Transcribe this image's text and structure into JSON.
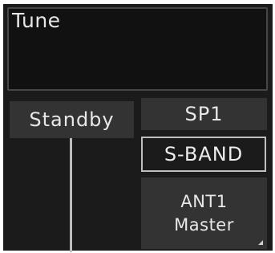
{
  "tune": {
    "label": "Tune"
  },
  "status": {
    "standby_label": "Standby"
  },
  "controls": {
    "sp1_label": "SP1",
    "band_label": "S-BAND",
    "antenna_line1": "ANT1",
    "antenna_line2": "Master"
  }
}
